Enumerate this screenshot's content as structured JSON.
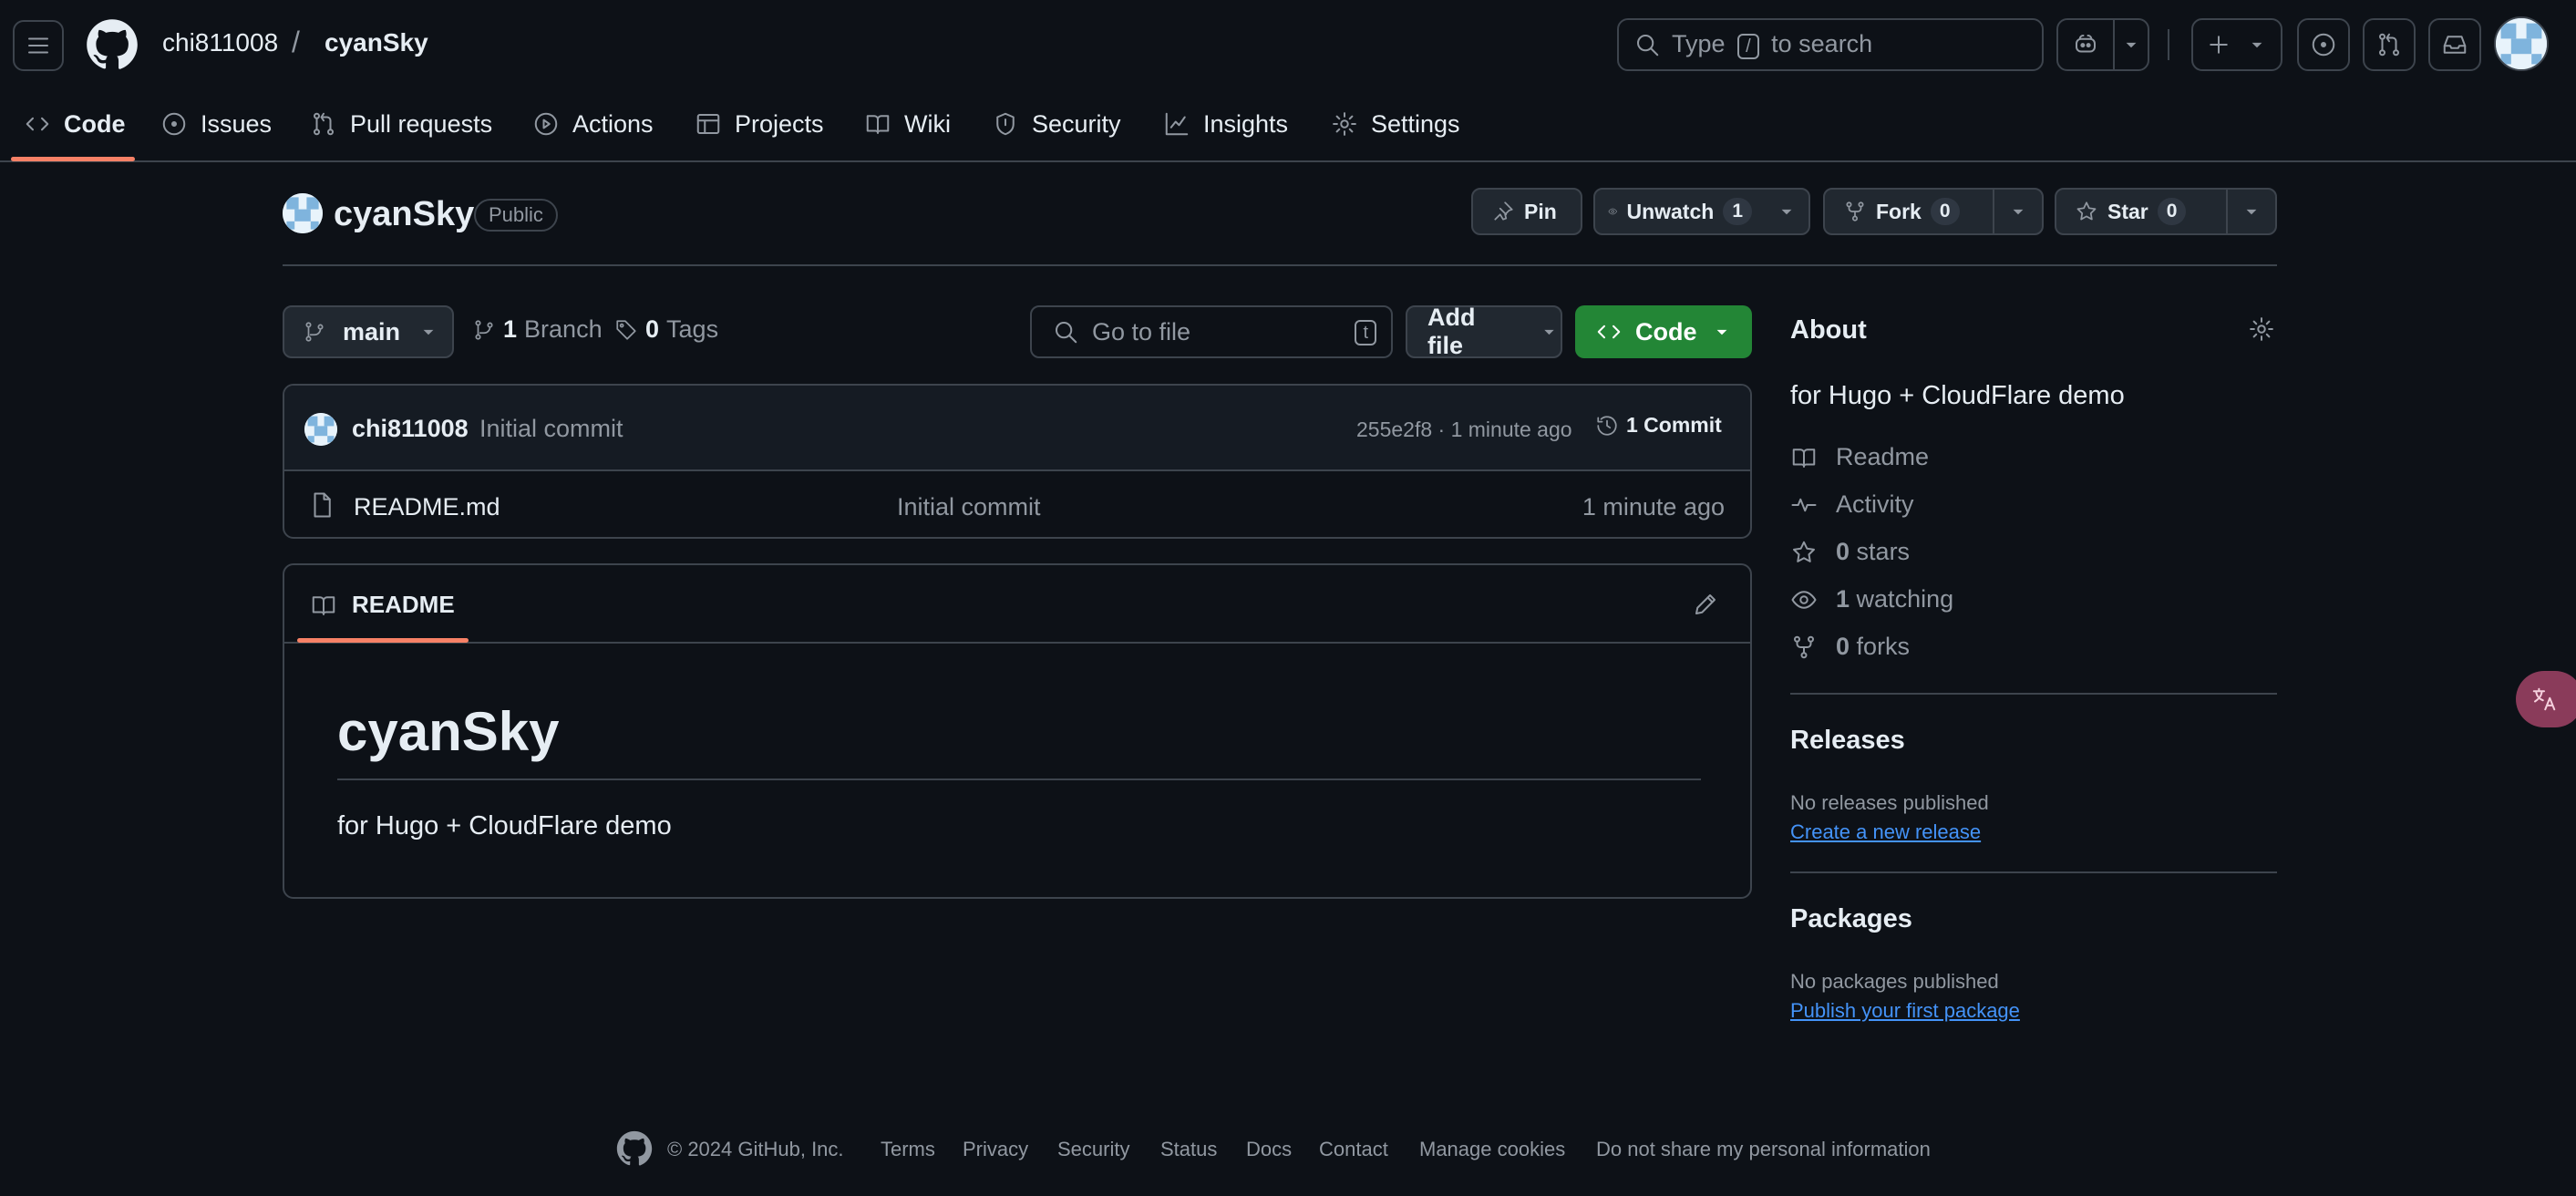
{
  "header": {
    "owner": "chi811008",
    "separator": "/",
    "repo": "cyanSky",
    "search_prefix": "Type",
    "search_key": "/",
    "search_suffix": "to search"
  },
  "nav": {
    "items": [
      {
        "label": "Code",
        "icon": "code-icon",
        "active": true
      },
      {
        "label": "Issues",
        "icon": "issue-icon"
      },
      {
        "label": "Pull requests",
        "icon": "pull-request-icon"
      },
      {
        "label": "Actions",
        "icon": "play-icon"
      },
      {
        "label": "Projects",
        "icon": "table-icon"
      },
      {
        "label": "Wiki",
        "icon": "book-icon"
      },
      {
        "label": "Security",
        "icon": "shield-icon"
      },
      {
        "label": "Insights",
        "icon": "graph-icon"
      },
      {
        "label": "Settings",
        "icon": "gear-icon"
      }
    ]
  },
  "repo": {
    "name": "cyanSky",
    "visibility": "Public",
    "pin_label": "Pin",
    "watch_label": "Unwatch",
    "watch_count": "1",
    "fork_label": "Fork",
    "fork_count": "0",
    "star_label": "Star",
    "star_count": "0"
  },
  "filebar": {
    "branch": "main",
    "branch_count": "1",
    "branch_label": "Branch",
    "tag_count": "0",
    "tag_label": "Tags",
    "goto_placeholder": "Go to file",
    "goto_key": "t",
    "add_file": "Add file",
    "code_button": "Code"
  },
  "latest_commit": {
    "author": "chi811008",
    "message": "Initial commit",
    "hash_time": "255e2f8 · 1 minute ago",
    "commit_count": "1 Commit"
  },
  "files": [
    {
      "name": "README.md",
      "commit": "Initial commit",
      "age": "1 minute ago"
    }
  ],
  "readme": {
    "tab_label": "README",
    "heading": "cyanSky",
    "body": "for Hugo + CloudFlare demo"
  },
  "about": {
    "title": "About",
    "description": "for Hugo + CloudFlare demo",
    "readme": "Readme",
    "activity": "Activity",
    "stars_count": "0",
    "stars_label": "stars",
    "watching_count": "1",
    "watching_label": "watching",
    "forks_count": "0",
    "forks_label": "forks"
  },
  "releases": {
    "title": "Releases",
    "text": "No releases published",
    "link": "Create a new release"
  },
  "packages": {
    "title": "Packages",
    "text": "No packages published",
    "link": "Publish your first package"
  },
  "footer": {
    "copyright": "© 2024 GitHub, Inc.",
    "links": [
      "Terms",
      "Privacy",
      "Security",
      "Status",
      "Docs",
      "Contact",
      "Manage cookies",
      "Do not share my personal information"
    ]
  },
  "colors": {
    "background": "#0d1117",
    "border": "#3d444d",
    "accent_underline": "#f78166",
    "primary_button": "#238636",
    "link": "#4493f8"
  }
}
